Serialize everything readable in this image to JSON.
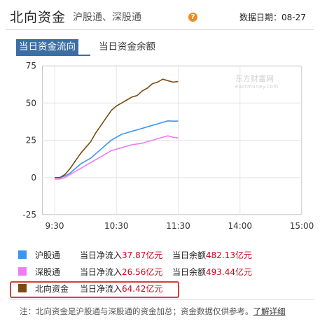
{
  "header": {
    "title": "北向资金",
    "subtitle": "沪股通、深股通",
    "help_icon": "question-icon",
    "date_label": "数据日期：08-27"
  },
  "tabs": [
    {
      "label": "当日资金流向",
      "active": true
    },
    {
      "label": "当日资金余额",
      "active": false
    }
  ],
  "watermark": {
    "brand": "东方财富网",
    "domain": "eastmoney.com"
  },
  "chart_data": {
    "type": "line",
    "x_ticks": [
      "9:30",
      "10:30",
      "11:30",
      "14:00",
      "15:00"
    ],
    "y_ticks": [
      "75",
      "50",
      "25",
      "0",
      "-25"
    ],
    "ylim": [
      -25,
      75
    ],
    "grid": true,
    "x_minutes_range": [
      0,
      240
    ],
    "series": [
      {
        "name": "沪股通",
        "color": "#3a96f0",
        "x": [
          0,
          5,
          10,
          15,
          20,
          25,
          30,
          35,
          40,
          45,
          50,
          55,
          60,
          65,
          70,
          75,
          80,
          85,
          90,
          95,
          100,
          105,
          110,
          115,
          120
        ],
        "y": [
          0,
          0,
          1,
          3,
          6,
          9,
          11,
          13,
          16,
          19,
          22,
          25,
          27,
          29,
          30,
          31,
          32,
          33,
          34,
          35,
          36,
          37,
          38,
          37.8,
          37.87
        ]
      },
      {
        "name": "深股通",
        "color": "#f07cf0",
        "x": [
          0,
          5,
          10,
          15,
          20,
          25,
          30,
          35,
          40,
          45,
          50,
          55,
          60,
          65,
          70,
          75,
          80,
          85,
          90,
          95,
          100,
          105,
          110,
          115,
          120
        ],
        "y": [
          -1,
          -1,
          0,
          2,
          4,
          6,
          8,
          10,
          12,
          14,
          16,
          18,
          19,
          20,
          21,
          22,
          22.5,
          23,
          24,
          25,
          26,
          27,
          28,
          27,
          26.56
        ]
      },
      {
        "name": "北向资金",
        "color": "#7a4a12",
        "x": [
          0,
          5,
          10,
          15,
          20,
          25,
          30,
          35,
          40,
          45,
          50,
          55,
          60,
          65,
          70,
          75,
          80,
          85,
          90,
          95,
          100,
          105,
          110,
          115,
          120
        ],
        "y": [
          0,
          0,
          2,
          6,
          11,
          16,
          20,
          24,
          30,
          35,
          40,
          45,
          48,
          50,
          52,
          54,
          55,
          58,
          60,
          63,
          64,
          66,
          65,
          64,
          64.42
        ]
      }
    ]
  },
  "legend": [
    {
      "name": "沪股通",
      "color": "#3a96f0",
      "inflow_label": "当日净流入",
      "inflow_value": "37.87亿元",
      "balance_label": "当日余额",
      "balance_value": "482.13亿元"
    },
    {
      "name": "深股通",
      "color": "#f07cf0",
      "inflow_label": "当日净流入",
      "inflow_value": "26.56亿元",
      "balance_label": "当日余额",
      "balance_value": "493.44亿元"
    },
    {
      "name": "北向资金",
      "color": "#7a4a12",
      "inflow_label": "当日净流入",
      "inflow_value": "64.42亿元",
      "balance_label": "",
      "balance_value": ""
    }
  ],
  "note": {
    "text": "注：北向资金是沪股通与深股通的资金加总；资金数据仅供参考。",
    "link": "了解详细"
  }
}
